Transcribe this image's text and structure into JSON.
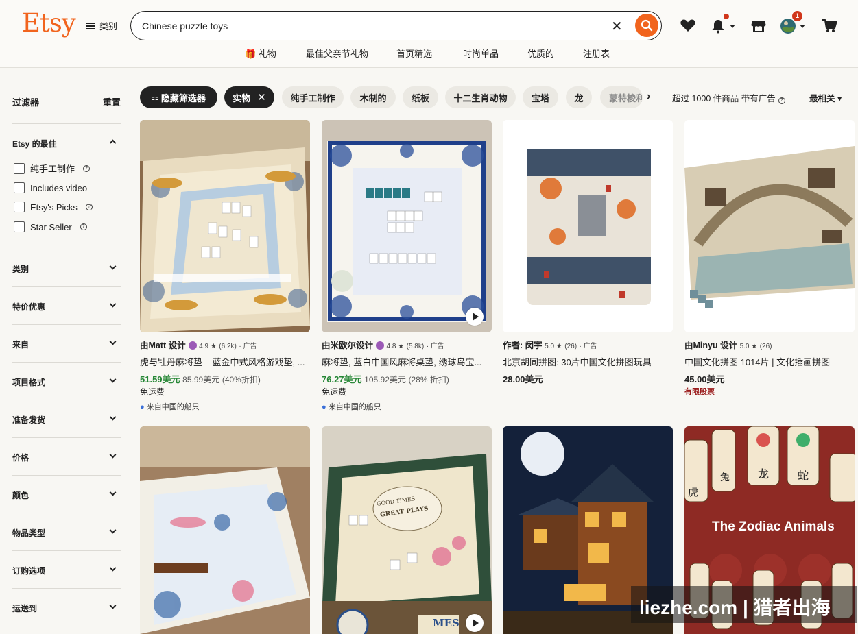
{
  "header": {
    "logo": "Etsy",
    "categories_label": "类别",
    "search_value": "Chinese puzzle toys",
    "cart_badge": "1",
    "nav": [
      "礼物",
      "最佳父亲节礼物",
      "首页精选",
      "时尚单品",
      "优质的",
      "注册表"
    ]
  },
  "sidebar": {
    "title": "过滤器",
    "reset": "重置",
    "best_title": "Etsy 的最佳",
    "best_options": [
      "纯手工制作",
      "Includes video",
      "Etsy's Picks",
      "Star Seller"
    ],
    "sections": [
      "类别",
      "特价优惠",
      "来自",
      "项目格式",
      "准备发货",
      "价格",
      "颜色",
      "物品类型",
      "订购选项",
      "运送到"
    ]
  },
  "chips": {
    "hide_filters": "隐藏筛选器",
    "active": "实物",
    "items": [
      "纯手工制作",
      "木制的",
      "纸板",
      "十二生肖动物",
      "宝塔",
      "龙",
      "蒙特梭利"
    ],
    "results": "超过 1000 件商品 带有广告",
    "sort": "最相关"
  },
  "products": [
    {
      "seller": "由Matt 设计",
      "rating": "4.9 ★",
      "reviews": "(6.2k)",
      "ad": "· 广告",
      "title": "虎与牡丹麻将垫 – 蓝金中式风格游戏垫, ...",
      "price": "51.59美元",
      "old_price": "85.99美元",
      "discount": "(40%折扣)",
      "shipping": "免运费",
      "origin": "来自中国的船只"
    },
    {
      "seller": "由米欧尔设计",
      "rating": "4.8 ★",
      "reviews": "(5.8k)",
      "ad": "· 广告",
      "title": "麻将垫, 蓝白中国风麻将桌垫, 绣球鸟宝...",
      "price": "76.27美元",
      "old_price": "105.92美元",
      "discount": "(28% 折扣)",
      "shipping": "免运费",
      "origin": "来自中国的船只"
    },
    {
      "seller": "作者: 闵宇",
      "rating": "5.0 ★",
      "reviews": "(26)",
      "ad": "· 广告",
      "title": "北京胡同拼图: 30片中国文化拼图玩具",
      "price": "28.00美元"
    },
    {
      "seller": "由Minyu 设计",
      "rating": "5.0 ★",
      "reviews": "(26)",
      "title": "中国文化拼图 1014片 | 文化插画拼图",
      "price": "45.00美元",
      "limited": "有限股票"
    }
  ],
  "image_text": {
    "zodiac_title": "The Zodiac Animals",
    "mat_text_1": "GOOD TIMES",
    "mat_text_2": "GREAT PLAYS",
    "mes": "MES",
    "zodiac_tiles": [
      "虎",
      "兔",
      "龙",
      "蛇"
    ]
  },
  "watermark": "liezhe.com  |  猎者出海",
  "colors": {
    "brand": "#f1641e",
    "sale_green": "#258635",
    "dark_chip": "#222222",
    "limited_red": "#9b1c1c"
  }
}
